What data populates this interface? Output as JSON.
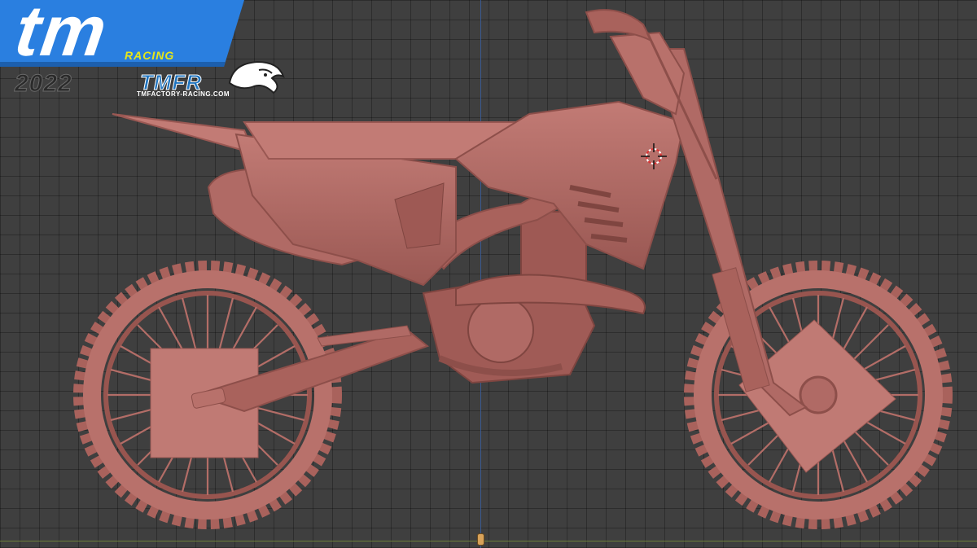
{
  "branding": {
    "logo_main": "tm",
    "logo_sub": "RACING",
    "year": "2022",
    "team": "TMFR",
    "team_site": "TMFACTORY-RACING.COM"
  },
  "viewport": {
    "object": "motorcycle-3d-model",
    "icons": [
      "3d-cursor-icon",
      "origin-marker-icon",
      "panther-logo-icon"
    ]
  },
  "colors": {
    "model": "#b06a65",
    "grid_bg": "#3f3f3f",
    "axis_z": "#3a5fa0",
    "axis_x": "#7a8f3a",
    "banner_blue": "#2a7fe0",
    "racing_yellow": "#e6e619"
  }
}
